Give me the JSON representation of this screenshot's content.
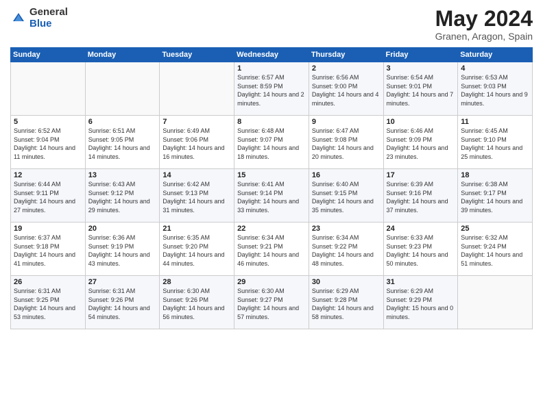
{
  "header": {
    "logo_general": "General",
    "logo_blue": "Blue",
    "month_title": "May 2024",
    "subtitle": "Granen, Aragon, Spain"
  },
  "days_of_week": [
    "Sunday",
    "Monday",
    "Tuesday",
    "Wednesday",
    "Thursday",
    "Friday",
    "Saturday"
  ],
  "weeks": [
    [
      {
        "day": "",
        "sunrise": "",
        "sunset": "",
        "daylight": ""
      },
      {
        "day": "",
        "sunrise": "",
        "sunset": "",
        "daylight": ""
      },
      {
        "day": "",
        "sunrise": "",
        "sunset": "",
        "daylight": ""
      },
      {
        "day": "1",
        "sunrise": "Sunrise: 6:57 AM",
        "sunset": "Sunset: 8:59 PM",
        "daylight": "Daylight: 14 hours and 2 minutes."
      },
      {
        "day": "2",
        "sunrise": "Sunrise: 6:56 AM",
        "sunset": "Sunset: 9:00 PM",
        "daylight": "Daylight: 14 hours and 4 minutes."
      },
      {
        "day": "3",
        "sunrise": "Sunrise: 6:54 AM",
        "sunset": "Sunset: 9:01 PM",
        "daylight": "Daylight: 14 hours and 7 minutes."
      },
      {
        "day": "4",
        "sunrise": "Sunrise: 6:53 AM",
        "sunset": "Sunset: 9:03 PM",
        "daylight": "Daylight: 14 hours and 9 minutes."
      }
    ],
    [
      {
        "day": "5",
        "sunrise": "Sunrise: 6:52 AM",
        "sunset": "Sunset: 9:04 PM",
        "daylight": "Daylight: 14 hours and 11 minutes."
      },
      {
        "day": "6",
        "sunrise": "Sunrise: 6:51 AM",
        "sunset": "Sunset: 9:05 PM",
        "daylight": "Daylight: 14 hours and 14 minutes."
      },
      {
        "day": "7",
        "sunrise": "Sunrise: 6:49 AM",
        "sunset": "Sunset: 9:06 PM",
        "daylight": "Daylight: 14 hours and 16 minutes."
      },
      {
        "day": "8",
        "sunrise": "Sunrise: 6:48 AM",
        "sunset": "Sunset: 9:07 PM",
        "daylight": "Daylight: 14 hours and 18 minutes."
      },
      {
        "day": "9",
        "sunrise": "Sunrise: 6:47 AM",
        "sunset": "Sunset: 9:08 PM",
        "daylight": "Daylight: 14 hours and 20 minutes."
      },
      {
        "day": "10",
        "sunrise": "Sunrise: 6:46 AM",
        "sunset": "Sunset: 9:09 PM",
        "daylight": "Daylight: 14 hours and 23 minutes."
      },
      {
        "day": "11",
        "sunrise": "Sunrise: 6:45 AM",
        "sunset": "Sunset: 9:10 PM",
        "daylight": "Daylight: 14 hours and 25 minutes."
      }
    ],
    [
      {
        "day": "12",
        "sunrise": "Sunrise: 6:44 AM",
        "sunset": "Sunset: 9:11 PM",
        "daylight": "Daylight: 14 hours and 27 minutes."
      },
      {
        "day": "13",
        "sunrise": "Sunrise: 6:43 AM",
        "sunset": "Sunset: 9:12 PM",
        "daylight": "Daylight: 14 hours and 29 minutes."
      },
      {
        "day": "14",
        "sunrise": "Sunrise: 6:42 AM",
        "sunset": "Sunset: 9:13 PM",
        "daylight": "Daylight: 14 hours and 31 minutes."
      },
      {
        "day": "15",
        "sunrise": "Sunrise: 6:41 AM",
        "sunset": "Sunset: 9:14 PM",
        "daylight": "Daylight: 14 hours and 33 minutes."
      },
      {
        "day": "16",
        "sunrise": "Sunrise: 6:40 AM",
        "sunset": "Sunset: 9:15 PM",
        "daylight": "Daylight: 14 hours and 35 minutes."
      },
      {
        "day": "17",
        "sunrise": "Sunrise: 6:39 AM",
        "sunset": "Sunset: 9:16 PM",
        "daylight": "Daylight: 14 hours and 37 minutes."
      },
      {
        "day": "18",
        "sunrise": "Sunrise: 6:38 AM",
        "sunset": "Sunset: 9:17 PM",
        "daylight": "Daylight: 14 hours and 39 minutes."
      }
    ],
    [
      {
        "day": "19",
        "sunrise": "Sunrise: 6:37 AM",
        "sunset": "Sunset: 9:18 PM",
        "daylight": "Daylight: 14 hours and 41 minutes."
      },
      {
        "day": "20",
        "sunrise": "Sunrise: 6:36 AM",
        "sunset": "Sunset: 9:19 PM",
        "daylight": "Daylight: 14 hours and 43 minutes."
      },
      {
        "day": "21",
        "sunrise": "Sunrise: 6:35 AM",
        "sunset": "Sunset: 9:20 PM",
        "daylight": "Daylight: 14 hours and 44 minutes."
      },
      {
        "day": "22",
        "sunrise": "Sunrise: 6:34 AM",
        "sunset": "Sunset: 9:21 PM",
        "daylight": "Daylight: 14 hours and 46 minutes."
      },
      {
        "day": "23",
        "sunrise": "Sunrise: 6:34 AM",
        "sunset": "Sunset: 9:22 PM",
        "daylight": "Daylight: 14 hours and 48 minutes."
      },
      {
        "day": "24",
        "sunrise": "Sunrise: 6:33 AM",
        "sunset": "Sunset: 9:23 PM",
        "daylight": "Daylight: 14 hours and 50 minutes."
      },
      {
        "day": "25",
        "sunrise": "Sunrise: 6:32 AM",
        "sunset": "Sunset: 9:24 PM",
        "daylight": "Daylight: 14 hours and 51 minutes."
      }
    ],
    [
      {
        "day": "26",
        "sunrise": "Sunrise: 6:31 AM",
        "sunset": "Sunset: 9:25 PM",
        "daylight": "Daylight: 14 hours and 53 minutes."
      },
      {
        "day": "27",
        "sunrise": "Sunrise: 6:31 AM",
        "sunset": "Sunset: 9:26 PM",
        "daylight": "Daylight: 14 hours and 54 minutes."
      },
      {
        "day": "28",
        "sunrise": "Sunrise: 6:30 AM",
        "sunset": "Sunset: 9:26 PM",
        "daylight": "Daylight: 14 hours and 56 minutes."
      },
      {
        "day": "29",
        "sunrise": "Sunrise: 6:30 AM",
        "sunset": "Sunset: 9:27 PM",
        "daylight": "Daylight: 14 hours and 57 minutes."
      },
      {
        "day": "30",
        "sunrise": "Sunrise: 6:29 AM",
        "sunset": "Sunset: 9:28 PM",
        "daylight": "Daylight: 14 hours and 58 minutes."
      },
      {
        "day": "31",
        "sunrise": "Sunrise: 6:29 AM",
        "sunset": "Sunset: 9:29 PM",
        "daylight": "Daylight: 15 hours and 0 minutes."
      },
      {
        "day": "",
        "sunrise": "",
        "sunset": "",
        "daylight": ""
      }
    ]
  ]
}
